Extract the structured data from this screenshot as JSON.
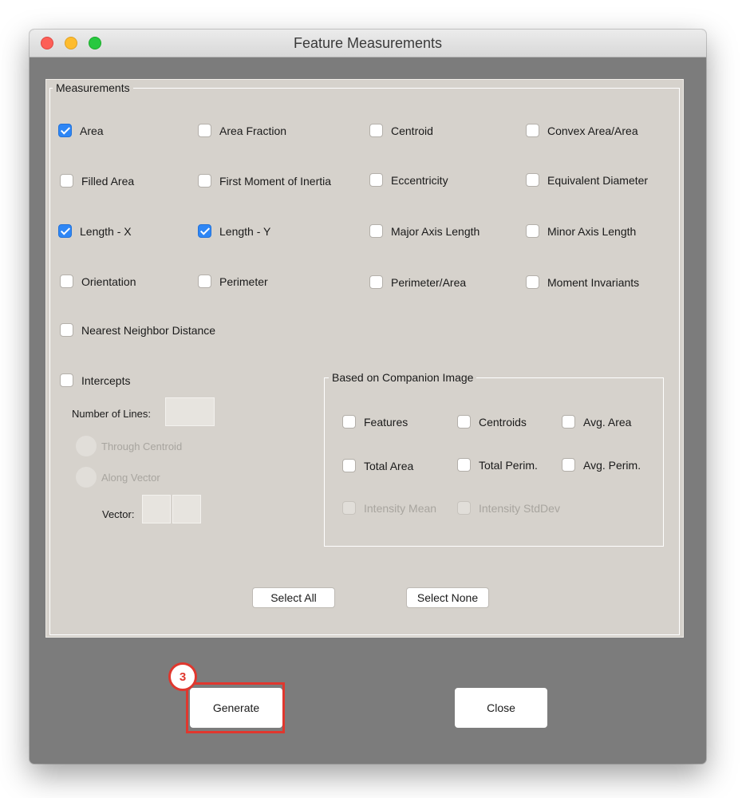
{
  "window": {
    "title": "Feature Measurements"
  },
  "measurements": {
    "legend": "Measurements",
    "checkboxes": [
      {
        "label": "Area",
        "checked": true
      },
      {
        "label": "Area Fraction",
        "checked": false
      },
      {
        "label": "Centroid",
        "checked": false
      },
      {
        "label": "Convex Area/Area",
        "checked": false
      },
      {
        "label": "Filled Area",
        "checked": false
      },
      {
        "label": "First Moment of Inertia",
        "checked": false
      },
      {
        "label": "Eccentricity",
        "checked": false
      },
      {
        "label": "Equivalent Diameter",
        "checked": false
      },
      {
        "label": "Length - X",
        "checked": true
      },
      {
        "label": "Length - Y",
        "checked": true
      },
      {
        "label": "Major Axis Length",
        "checked": false
      },
      {
        "label": "Minor Axis Length",
        "checked": false
      },
      {
        "label": "Orientation",
        "checked": false
      },
      {
        "label": "Perimeter",
        "checked": false
      },
      {
        "label": "Perimeter/Area",
        "checked": false
      },
      {
        "label": "Moment Invariants",
        "checked": false
      },
      {
        "label": "Nearest Neighbor Distance",
        "checked": false
      }
    ]
  },
  "intercepts": {
    "label": "Intercepts",
    "checked": false,
    "number_of_lines_label": "Number of Lines:",
    "number_of_lines_value": "",
    "options": [
      {
        "label": "Through Centroid",
        "enabled": false
      },
      {
        "label": "Along Vector",
        "enabled": false
      }
    ],
    "vector_label": "Vector:",
    "vector_values": [
      "",
      ""
    ]
  },
  "companion": {
    "legend": "Based on Companion Image",
    "checkboxes": [
      {
        "label": "Features",
        "checked": false,
        "enabled": true
      },
      {
        "label": "Centroids",
        "checked": false,
        "enabled": true
      },
      {
        "label": "Avg. Area",
        "checked": false,
        "enabled": true
      },
      {
        "label": "Total Area",
        "checked": false,
        "enabled": true
      },
      {
        "label": "Total Perim.",
        "checked": false,
        "enabled": true
      },
      {
        "label": "Avg. Perim.",
        "checked": false,
        "enabled": true
      },
      {
        "label": "Intensity Mean",
        "checked": false,
        "enabled": false
      },
      {
        "label": "Intensity StdDev",
        "checked": false,
        "enabled": false
      }
    ]
  },
  "buttons": {
    "select_all": "Select All",
    "select_none": "Select None",
    "generate": "Generate",
    "close": "Close"
  },
  "annotation": {
    "step_number": "3",
    "color": "#e0372e"
  },
  "colors": {
    "accent": "#2e86f5",
    "panel": "#d6d2cc",
    "window_bg": "#7c7c7c"
  }
}
